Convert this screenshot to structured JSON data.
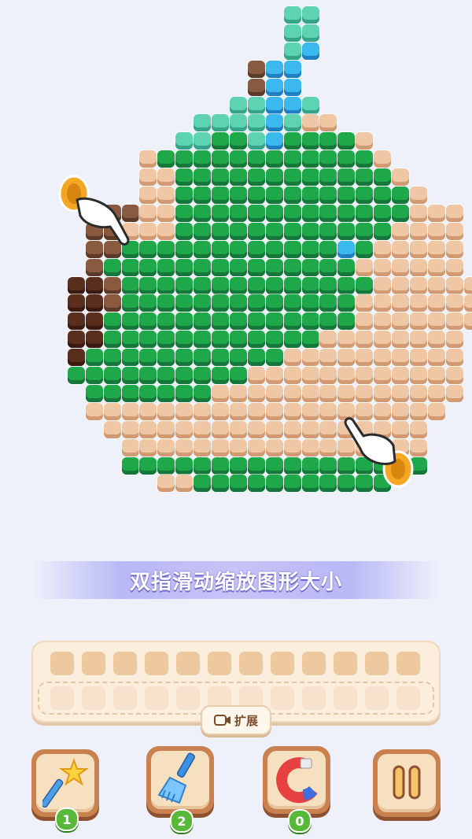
{
  "hint_text": "双指滑动缩放图形大小",
  "expand_label": "扩展",
  "tools": [
    {
      "name": "magic-wand",
      "count": "1"
    },
    {
      "name": "broom",
      "count": "2"
    },
    {
      "name": "magnet",
      "count": "0"
    }
  ],
  "colors": {
    "green": "#1fa84a",
    "tan": "#f0c7a4",
    "teal": "#5ed3b2",
    "blue": "#3bb8ee",
    "brown": "#8a5a40",
    "dark_brown": "#5a2e1c",
    "slot": "#eec9a0"
  }
}
